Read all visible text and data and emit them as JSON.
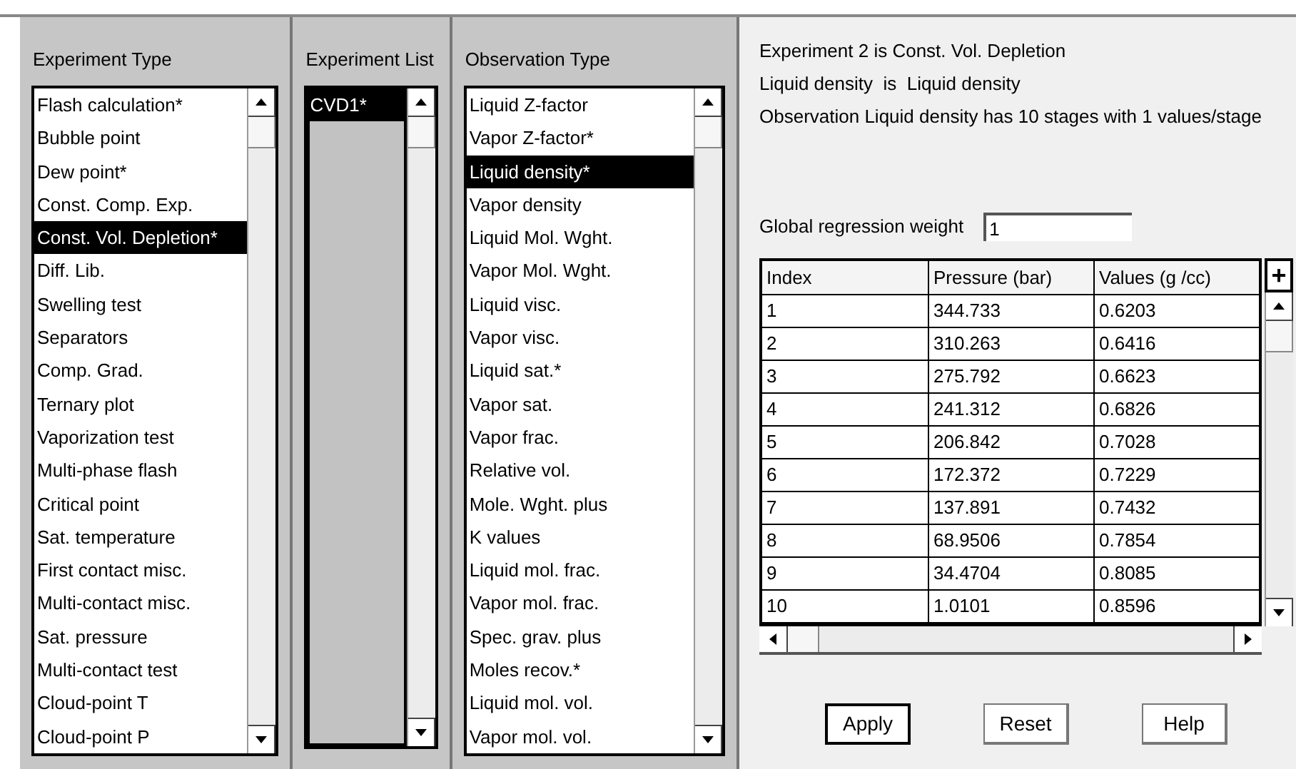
{
  "experiment_type": {
    "title": "Experiment Type",
    "items": [
      {
        "label": "Flash calculation*",
        "selected": false
      },
      {
        "label": "Bubble point",
        "selected": false
      },
      {
        "label": "Dew point*",
        "selected": false
      },
      {
        "label": "Const. Comp. Exp.",
        "selected": false
      },
      {
        "label": "Const. Vol. Depletion*",
        "selected": true
      },
      {
        "label": "Diff. Lib.",
        "selected": false
      },
      {
        "label": "Swelling test",
        "selected": false
      },
      {
        "label": "Separators",
        "selected": false
      },
      {
        "label": "Comp. Grad.",
        "selected": false
      },
      {
        "label": "Ternary plot",
        "selected": false
      },
      {
        "label": "Vaporization test",
        "selected": false
      },
      {
        "label": "Multi-phase flash",
        "selected": false
      },
      {
        "label": "Critical point",
        "selected": false
      },
      {
        "label": "Sat. temperature",
        "selected": false
      },
      {
        "label": "First contact misc.",
        "selected": false
      },
      {
        "label": "Multi-contact misc.",
        "selected": false
      },
      {
        "label": "Sat. pressure",
        "selected": false
      },
      {
        "label": "Multi-contact test",
        "selected": false
      },
      {
        "label": "Cloud-point T",
        "selected": false
      },
      {
        "label": "Cloud-point P",
        "selected": false
      }
    ]
  },
  "experiment_list": {
    "title": "Experiment List",
    "items": [
      {
        "label": "CVD1*",
        "selected": true
      }
    ]
  },
  "observation_type": {
    "title": "Observation Type",
    "items": [
      {
        "label": "Liquid Z-factor",
        "selected": false
      },
      {
        "label": "Vapor Z-factor*",
        "selected": false
      },
      {
        "label": "Liquid density*",
        "selected": true
      },
      {
        "label": "Vapor density",
        "selected": false
      },
      {
        "label": "Liquid Mol. Wght.",
        "selected": false
      },
      {
        "label": "Vapor Mol. Wght.",
        "selected": false
      },
      {
        "label": "Liquid visc.",
        "selected": false
      },
      {
        "label": "Vapor visc.",
        "selected": false
      },
      {
        "label": "Liquid sat.*",
        "selected": false
      },
      {
        "label": "Vapor sat.",
        "selected": false
      },
      {
        "label": "Vapor frac.",
        "selected": false
      },
      {
        "label": "Relative vol.",
        "selected": false
      },
      {
        "label": "Mole. Wght. plus",
        "selected": false
      },
      {
        "label": "K values",
        "selected": false
      },
      {
        "label": "Liquid mol. frac.",
        "selected": false
      },
      {
        "label": "Vapor mol. frac.",
        "selected": false
      },
      {
        "label": "Spec. grav. plus",
        "selected": false
      },
      {
        "label": "Moles recov.*",
        "selected": false
      },
      {
        "label": "Liquid mol. vol.",
        "selected": false
      },
      {
        "label": "Vapor mol. vol.",
        "selected": false
      }
    ]
  },
  "info_lines": [
    "Experiment 2 is Const. Vol. Depletion",
    "Liquid density  is  Liquid density",
    "Observation Liquid density has 10 stages with 1 values/stage"
  ],
  "global_weight": {
    "label": "Global regression weight",
    "value": "1"
  },
  "table": {
    "columns": [
      "Index",
      "Pressure (bar)",
      "Values (g /cc)"
    ],
    "add_symbol": "+",
    "rows": [
      [
        "1",
        "344.733",
        "0.6203"
      ],
      [
        "2",
        "310.263",
        "0.6416"
      ],
      [
        "3",
        "275.792",
        "0.6623"
      ],
      [
        "4",
        "241.312",
        "0.6826"
      ],
      [
        "5",
        "206.842",
        "0.7028"
      ],
      [
        "6",
        "172.372",
        "0.7229"
      ],
      [
        "7",
        "137.891",
        "0.7432"
      ],
      [
        "8",
        "68.9506",
        "0.7854"
      ],
      [
        "9",
        "34.4704",
        "0.8085"
      ],
      [
        "10",
        "1.0101",
        "0.8596"
      ]
    ]
  },
  "buttons": [
    "Apply",
    "Reset",
    "Help"
  ]
}
